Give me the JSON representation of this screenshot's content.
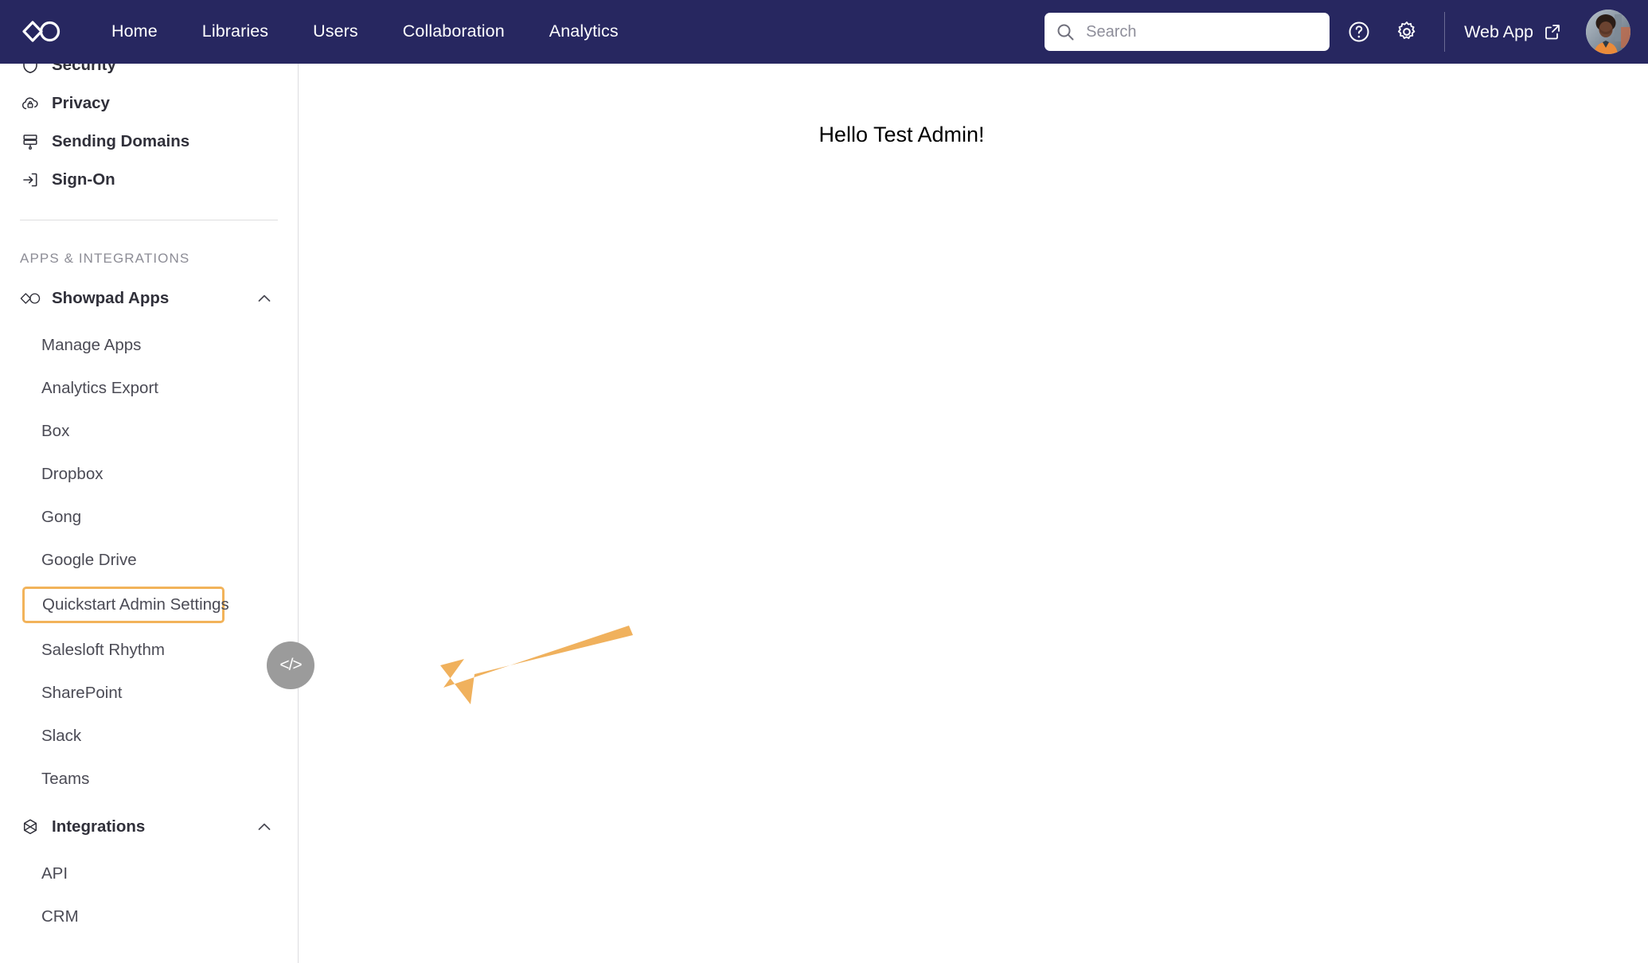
{
  "theme": {
    "nav_bg": "#272760",
    "accent_highlight": "#f2b35a",
    "fab_bg": "#9b9b9b",
    "text_dark": "#30303a"
  },
  "topnav": {
    "logo_icon": "showpad-logo-icon",
    "links": [
      {
        "label": "Home"
      },
      {
        "label": "Libraries"
      },
      {
        "label": "Users"
      },
      {
        "label": "Collaboration"
      },
      {
        "label": "Analytics"
      }
    ],
    "search": {
      "icon": "search-icon",
      "placeholder": "Search",
      "value": ""
    },
    "help_icon": "help-circle-icon",
    "settings_icon": "gear-icon",
    "web_app": {
      "label": "Web App",
      "icon": "external-link-icon"
    },
    "avatar_label": "user-avatar"
  },
  "sidebar": {
    "items": [
      {
        "label": "Security",
        "icon": "shield-icon"
      },
      {
        "label": "Privacy",
        "icon": "cloud-lock-icon"
      },
      {
        "label": "Sending Domains",
        "icon": "server-icon"
      },
      {
        "label": "Sign-On",
        "icon": "sign-in-arrow-icon"
      }
    ],
    "section_title": "APPS & INTEGRATIONS",
    "groups": [
      {
        "label": "Showpad Apps",
        "icon": "showpad-logo-icon",
        "chevron": "chevron-up-icon",
        "expanded": true,
        "items": [
          {
            "label": "Manage Apps",
            "highlighted": false
          },
          {
            "label": "Analytics Export",
            "highlighted": false
          },
          {
            "label": "Box",
            "highlighted": false
          },
          {
            "label": "Dropbox",
            "highlighted": false
          },
          {
            "label": "Gong",
            "highlighted": false
          },
          {
            "label": "Google Drive",
            "highlighted": false
          },
          {
            "label": "Quickstart Admin Settings",
            "highlighted": true
          },
          {
            "label": "Salesloft Rhythm",
            "highlighted": false
          },
          {
            "label": "SharePoint",
            "highlighted": false
          },
          {
            "label": "Slack",
            "highlighted": false
          },
          {
            "label": "Teams",
            "highlighted": false
          }
        ]
      },
      {
        "label": "Integrations",
        "icon": "hexagon-x-icon",
        "chevron": "chevron-up-icon",
        "expanded": true,
        "items": [
          {
            "label": "API",
            "highlighted": false
          },
          {
            "label": "CRM",
            "highlighted": false
          }
        ]
      }
    ]
  },
  "main": {
    "greeting": "Hello Test Admin!",
    "fab": {
      "label": "</>",
      "icon": "code-icon"
    },
    "annotation_arrow": "pointer-arrow-icon"
  }
}
